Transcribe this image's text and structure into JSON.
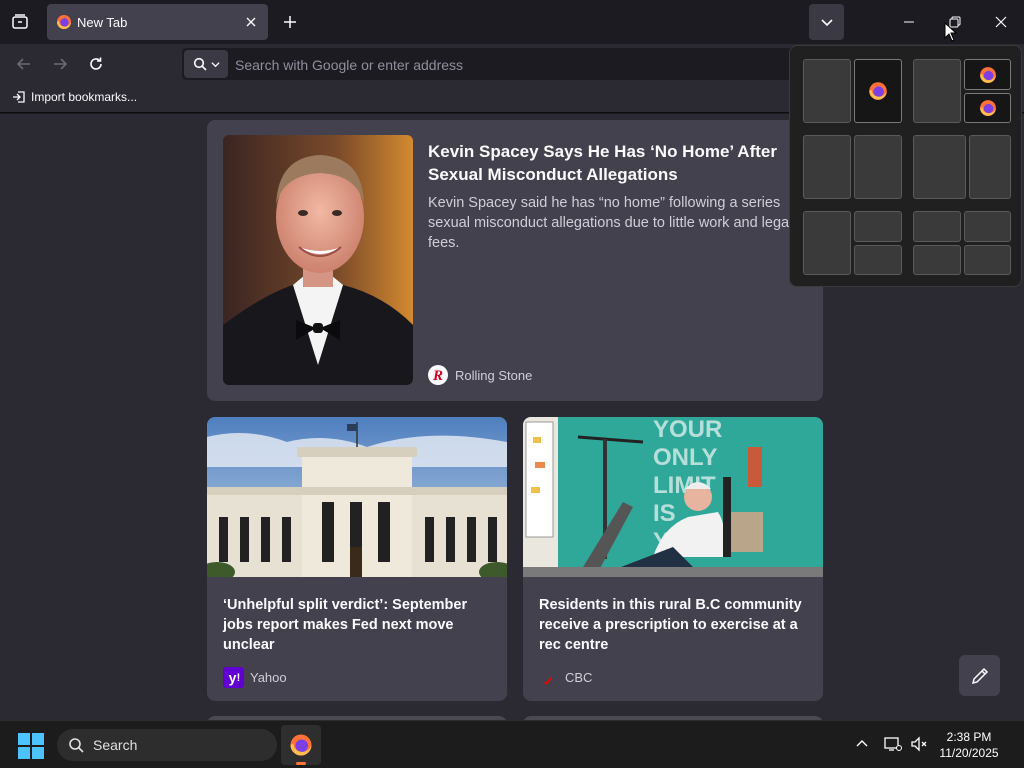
{
  "tab": {
    "title": "New Tab"
  },
  "urlbar": {
    "placeholder": "Search with Google or enter address"
  },
  "bookmarks": {
    "import_label": "Import bookmarks..."
  },
  "stories": [
    {
      "headline": "Kevin Spacey Says He Has ‘No Home’ After Sexual Misconduct Allegations",
      "excerpt": "Kevin Spacey said he has “no home” following a series sexual misconduct allegations due to little work and legal fees.",
      "source": "Rolling Stone"
    },
    {
      "headline": "‘Unhelpful split verdict’: September jobs report makes Fed next move unclear",
      "source": "Yahoo"
    },
    {
      "headline": "Residents in this rural B.C community receive a prescription to exercise at a rec centre",
      "source": "CBC"
    }
  ],
  "photo_text": {
    "gym_wall": [
      "YOUR",
      "ONLY",
      "LIMIT",
      "IS",
      "YO"
    ]
  },
  "taskbar": {
    "search_label": "Search",
    "time": "2:38 PM",
    "date": "11/20/2025"
  },
  "colors": {
    "accent_firefox": "#ff7139",
    "tab_active": "#42414d",
    "page_bg": "#2b2a33",
    "card_bg": "#42414d"
  },
  "icons": [
    "tab-list-icon",
    "firefox-icon",
    "close-icon",
    "plus-icon",
    "chevron-down-icon",
    "minimize-icon",
    "restore-icon",
    "back-arrow-icon",
    "forward-arrow-icon",
    "reload-icon",
    "search-icon",
    "import-icon",
    "pencil-icon",
    "windows-logo-icon",
    "chevron-up-icon",
    "network-icon",
    "volume-muted-icon"
  ]
}
